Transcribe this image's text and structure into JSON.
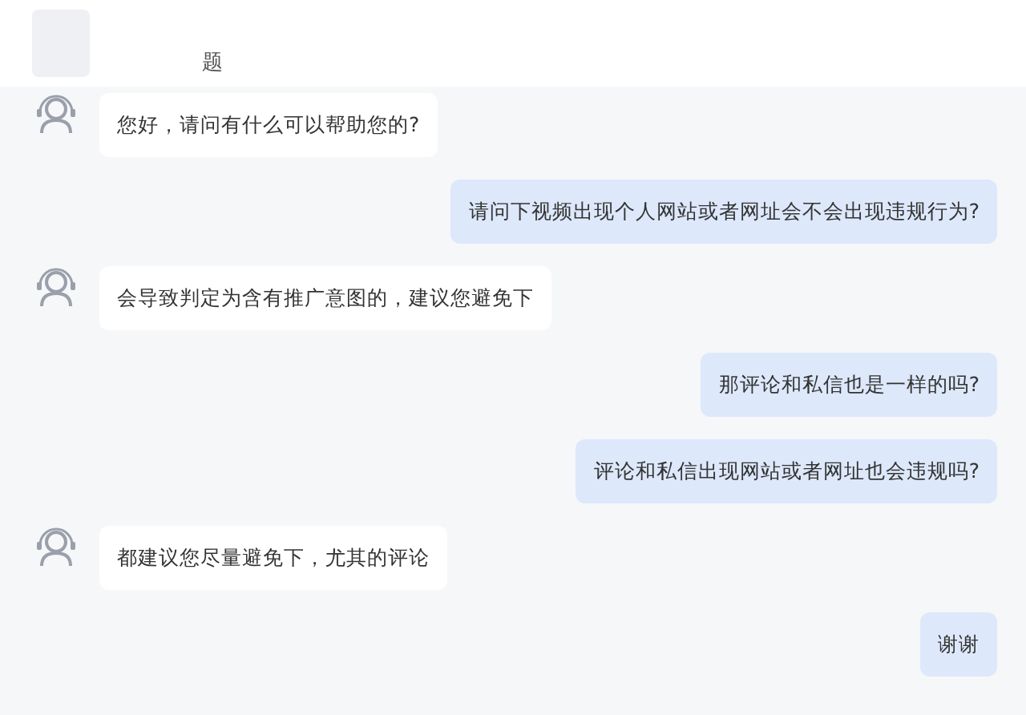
{
  "header": {
    "subtitle": "题"
  },
  "messages": [
    {
      "kind": "agent",
      "text": "您好，请问有什么可以帮助您的?"
    },
    {
      "kind": "user",
      "text": "请问下视频出现个人网站或者网址会不会出现违规行为?"
    },
    {
      "kind": "agent",
      "text": "会导致判定为含有推广意图的，建议您避免下"
    },
    {
      "kind": "user",
      "text": "那评论和私信也是一样的吗?"
    },
    {
      "kind": "user",
      "text": "评论和私信出现网站或者网址也会违规吗?"
    },
    {
      "kind": "agent",
      "text": "都建议您尽量避免下，尤其的评论"
    },
    {
      "kind": "user",
      "text": "谢谢"
    }
  ]
}
